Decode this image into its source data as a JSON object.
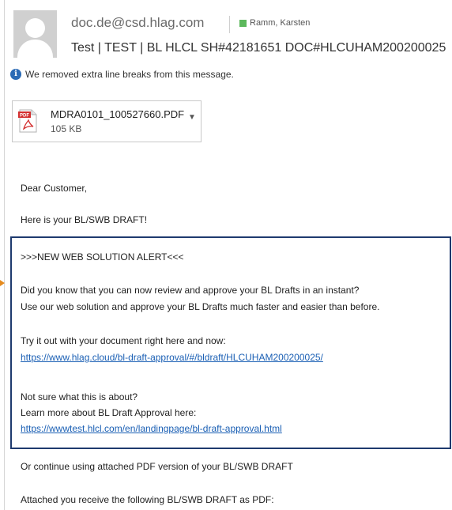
{
  "header": {
    "sender": "doc.de@csd.hlag.com",
    "recipient": "Ramm, Karsten",
    "subject": "Test | TEST | BL HLCL SH#42181651 DOC#HLCUHAM200200025",
    "info_message": "We removed extra line breaks from this message.",
    "presence_color": "#5cb85c"
  },
  "attachment": {
    "filename": "MDRA0101_100527660.PDF",
    "size": "105 KB",
    "icon": "pdf-icon",
    "icon_label": "PDF"
  },
  "body": {
    "greeting": "Dear Customer,",
    "intro": "Here is your BL/SWB DRAFT!",
    "alert": {
      "title": ">>>NEW WEB SOLUTION ALERT<<<",
      "line1": "Did you know that you can now review and approve your BL Drafts in an instant?",
      "line2": "Use our web solution and approve your BL Drafts much faster and easier than before.",
      "try_text": "Try it out with your document right here and now:",
      "try_link": "https://www.hlag.cloud/bl-draft-approval/#/bldraft/HLCUHAM200200025/",
      "not_sure": "Not sure what this is about?",
      "learn_more": "Learn more about BL Draft Approval here:",
      "learn_link": "https://wwwtest.hlcl.com/en/landingpage/bl-draft-approval.html",
      "border_color": "#1e3a6e"
    },
    "continue_text": "Or continue using attached PDF version of your BL/SWB DRAFT",
    "attached_text": "Attached you receive the following BL/SWB DRAFT as PDF:"
  }
}
